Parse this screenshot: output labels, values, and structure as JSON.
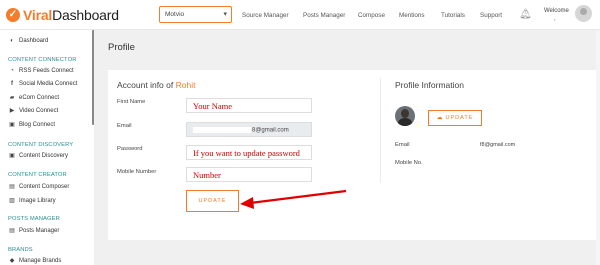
{
  "header": {
    "logo_check": "✓",
    "logo_word1": "Viral",
    "logo_word2": "Dashboard",
    "account_select": "Motvio",
    "nav": [
      "Source Manager",
      "Posts Manager",
      "Compose",
      "Mentions",
      "Tutorials",
      "Support"
    ],
    "notification_count": "0",
    "welcome": "Welcome",
    "welcome_name": ","
  },
  "sidebar": {
    "dashboard": "Dashboard",
    "sections": [
      {
        "title": "CONTENT CONNECTOR",
        "items": [
          "RSS Feeds Connect",
          "Social Media Connect",
          "eCom Connect",
          "Video Connect",
          "Blog Connect"
        ]
      },
      {
        "title": "CONTENT DISCOVERY",
        "items": [
          "Content Discovery"
        ]
      },
      {
        "title": "CONTENT CREATOR",
        "items": [
          "Content Composer",
          "Image Library"
        ]
      },
      {
        "title": "POSTS MANAGER",
        "items": [
          "Posts Manager"
        ]
      },
      {
        "title": "BRANDS",
        "items": [
          "Manage Brands"
        ]
      }
    ]
  },
  "page": {
    "title": "Profile",
    "account": {
      "title_prefix": "Account info of",
      "name": "Rohit",
      "first_name_label": "First Name",
      "first_name_value": "Your Name",
      "email_label": "Email",
      "email_value": "8@gmail.com",
      "password_label": "Password",
      "password_value": "If you want to update password",
      "mobile_label": "Mobile Number",
      "mobile_value": "Number",
      "update_label": "UPDATE"
    },
    "profile": {
      "title": "Profile Information",
      "update_label": "UPDATE",
      "email_label": "Email",
      "email_value": "f8@gmail.com",
      "mobile_label": "Mobile No."
    }
  },
  "colors": {
    "accent": "#f57c2b",
    "teal": "#2a8f8f",
    "annotation": "#e00000"
  }
}
